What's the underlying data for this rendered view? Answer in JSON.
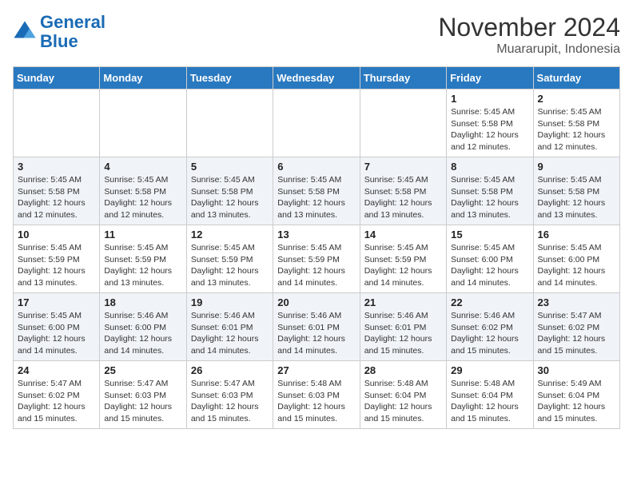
{
  "logo": {
    "line1": "General",
    "line2": "Blue"
  },
  "title": "November 2024",
  "location": "Muararupit, Indonesia",
  "days_of_week": [
    "Sunday",
    "Monday",
    "Tuesday",
    "Wednesday",
    "Thursday",
    "Friday",
    "Saturday"
  ],
  "weeks": [
    [
      {
        "num": "",
        "info": ""
      },
      {
        "num": "",
        "info": ""
      },
      {
        "num": "",
        "info": ""
      },
      {
        "num": "",
        "info": ""
      },
      {
        "num": "",
        "info": ""
      },
      {
        "num": "1",
        "info": "Sunrise: 5:45 AM\nSunset: 5:58 PM\nDaylight: 12 hours\nand 12 minutes."
      },
      {
        "num": "2",
        "info": "Sunrise: 5:45 AM\nSunset: 5:58 PM\nDaylight: 12 hours\nand 12 minutes."
      }
    ],
    [
      {
        "num": "3",
        "info": "Sunrise: 5:45 AM\nSunset: 5:58 PM\nDaylight: 12 hours\nand 12 minutes."
      },
      {
        "num": "4",
        "info": "Sunrise: 5:45 AM\nSunset: 5:58 PM\nDaylight: 12 hours\nand 12 minutes."
      },
      {
        "num": "5",
        "info": "Sunrise: 5:45 AM\nSunset: 5:58 PM\nDaylight: 12 hours\nand 13 minutes."
      },
      {
        "num": "6",
        "info": "Sunrise: 5:45 AM\nSunset: 5:58 PM\nDaylight: 12 hours\nand 13 minutes."
      },
      {
        "num": "7",
        "info": "Sunrise: 5:45 AM\nSunset: 5:58 PM\nDaylight: 12 hours\nand 13 minutes."
      },
      {
        "num": "8",
        "info": "Sunrise: 5:45 AM\nSunset: 5:58 PM\nDaylight: 12 hours\nand 13 minutes."
      },
      {
        "num": "9",
        "info": "Sunrise: 5:45 AM\nSunset: 5:58 PM\nDaylight: 12 hours\nand 13 minutes."
      }
    ],
    [
      {
        "num": "10",
        "info": "Sunrise: 5:45 AM\nSunset: 5:59 PM\nDaylight: 12 hours\nand 13 minutes."
      },
      {
        "num": "11",
        "info": "Sunrise: 5:45 AM\nSunset: 5:59 PM\nDaylight: 12 hours\nand 13 minutes."
      },
      {
        "num": "12",
        "info": "Sunrise: 5:45 AM\nSunset: 5:59 PM\nDaylight: 12 hours\nand 13 minutes."
      },
      {
        "num": "13",
        "info": "Sunrise: 5:45 AM\nSunset: 5:59 PM\nDaylight: 12 hours\nand 14 minutes."
      },
      {
        "num": "14",
        "info": "Sunrise: 5:45 AM\nSunset: 5:59 PM\nDaylight: 12 hours\nand 14 minutes."
      },
      {
        "num": "15",
        "info": "Sunrise: 5:45 AM\nSunset: 6:00 PM\nDaylight: 12 hours\nand 14 minutes."
      },
      {
        "num": "16",
        "info": "Sunrise: 5:45 AM\nSunset: 6:00 PM\nDaylight: 12 hours\nand 14 minutes."
      }
    ],
    [
      {
        "num": "17",
        "info": "Sunrise: 5:45 AM\nSunset: 6:00 PM\nDaylight: 12 hours\nand 14 minutes."
      },
      {
        "num": "18",
        "info": "Sunrise: 5:46 AM\nSunset: 6:00 PM\nDaylight: 12 hours\nand 14 minutes."
      },
      {
        "num": "19",
        "info": "Sunrise: 5:46 AM\nSunset: 6:01 PM\nDaylight: 12 hours\nand 14 minutes."
      },
      {
        "num": "20",
        "info": "Sunrise: 5:46 AM\nSunset: 6:01 PM\nDaylight: 12 hours\nand 14 minutes."
      },
      {
        "num": "21",
        "info": "Sunrise: 5:46 AM\nSunset: 6:01 PM\nDaylight: 12 hours\nand 15 minutes."
      },
      {
        "num": "22",
        "info": "Sunrise: 5:46 AM\nSunset: 6:02 PM\nDaylight: 12 hours\nand 15 minutes."
      },
      {
        "num": "23",
        "info": "Sunrise: 5:47 AM\nSunset: 6:02 PM\nDaylight: 12 hours\nand 15 minutes."
      }
    ],
    [
      {
        "num": "24",
        "info": "Sunrise: 5:47 AM\nSunset: 6:02 PM\nDaylight: 12 hours\nand 15 minutes."
      },
      {
        "num": "25",
        "info": "Sunrise: 5:47 AM\nSunset: 6:03 PM\nDaylight: 12 hours\nand 15 minutes."
      },
      {
        "num": "26",
        "info": "Sunrise: 5:47 AM\nSunset: 6:03 PM\nDaylight: 12 hours\nand 15 minutes."
      },
      {
        "num": "27",
        "info": "Sunrise: 5:48 AM\nSunset: 6:03 PM\nDaylight: 12 hours\nand 15 minutes."
      },
      {
        "num": "28",
        "info": "Sunrise: 5:48 AM\nSunset: 6:04 PM\nDaylight: 12 hours\nand 15 minutes."
      },
      {
        "num": "29",
        "info": "Sunrise: 5:48 AM\nSunset: 6:04 PM\nDaylight: 12 hours\nand 15 minutes."
      },
      {
        "num": "30",
        "info": "Sunrise: 5:49 AM\nSunset: 6:04 PM\nDaylight: 12 hours\nand 15 minutes."
      }
    ]
  ]
}
